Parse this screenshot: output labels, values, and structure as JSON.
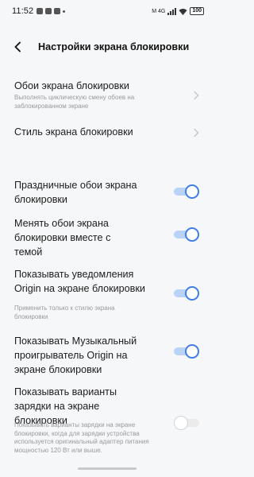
{
  "status": {
    "time": "11:52",
    "right_text": "M 4G",
    "battery": "100"
  },
  "header": {
    "title": "Настройки экрана блокировки"
  },
  "items": [
    {
      "title": "Обои экрана блокировки",
      "subtitle": "Выполнять циклическую смену обоев на заблокированном экране",
      "control": "chevron"
    },
    {
      "title": "Стиль экрана блокировки",
      "subtitle": "",
      "control": "chevron"
    },
    {
      "title": "Праздничные обои экрана блокировки",
      "subtitle": "",
      "control": "toggle",
      "enabled": true
    },
    {
      "title": "Менять обои экрана блокировки вместе с темой",
      "subtitle": "",
      "control": "toggle",
      "enabled": true
    },
    {
      "title": "Показывать уведомления Origin на экране блокировки",
      "subtitle": "Применить только к стилю экрана блокировки",
      "control": "toggle",
      "enabled": true
    },
    {
      "title": "Показывать Музыкальный проигрыватель Origin на экране блокировки",
      "subtitle": "",
      "control": "toggle",
      "enabled": true
    },
    {
      "title": "Показывать варианты зарядки на экране блокировки",
      "subtitle": "Показывать варианты зарядки на экране блокировки, когда для зарядки устройства используется оригинальный адаптер питания мощностью 120 Вт или выше.",
      "control": "toggle",
      "enabled": false
    }
  ],
  "colors": {
    "accent": "#3f7de8",
    "toggle_track_on": "#b9d3f8",
    "background": "#f6f7f9"
  }
}
